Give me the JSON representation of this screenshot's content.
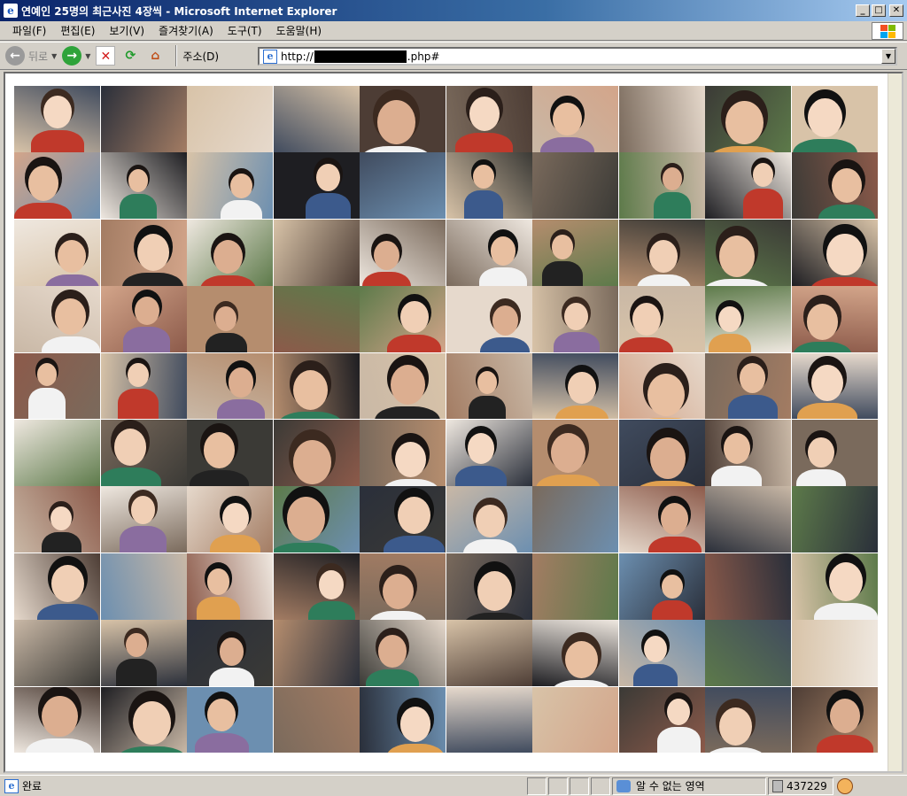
{
  "window": {
    "title": "연예인 25명의 최근사진 4장씩 - Microsoft Internet Explorer",
    "app_icon_glyph": "e",
    "buttons": {
      "minimize": "_",
      "maximize": "□",
      "close": "✕"
    }
  },
  "menu": {
    "items": [
      "파일(F)",
      "편집(E)",
      "보기(V)",
      "즐겨찾기(A)",
      "도구(T)",
      "도움말(H)"
    ]
  },
  "toolbar": {
    "back_glyph": "←",
    "back_label": "뒤로",
    "dropdown_glyph": "▼",
    "forward_glyph": "→",
    "stop_glyph": "✕",
    "refresh_glyph": "⟳",
    "home_glyph": "⌂",
    "address_label": "주소(D)",
    "address_protocol": "http://",
    "address_suffix": ".php#",
    "address_dropdown_glyph": "▼",
    "page_icon_glyph": "e"
  },
  "content": {
    "photo_grid": {
      "rows": 10,
      "cols": 10
    }
  },
  "status": {
    "text": "완료",
    "zone": "알 수 없는 영역",
    "counter": "437229",
    "page_icon_glyph": "e"
  },
  "colors": {
    "title_gradient_start": "#0a246a",
    "title_gradient_end": "#a6caf0",
    "chrome": "#d4d0c8",
    "content_bg": "#ffffff"
  }
}
